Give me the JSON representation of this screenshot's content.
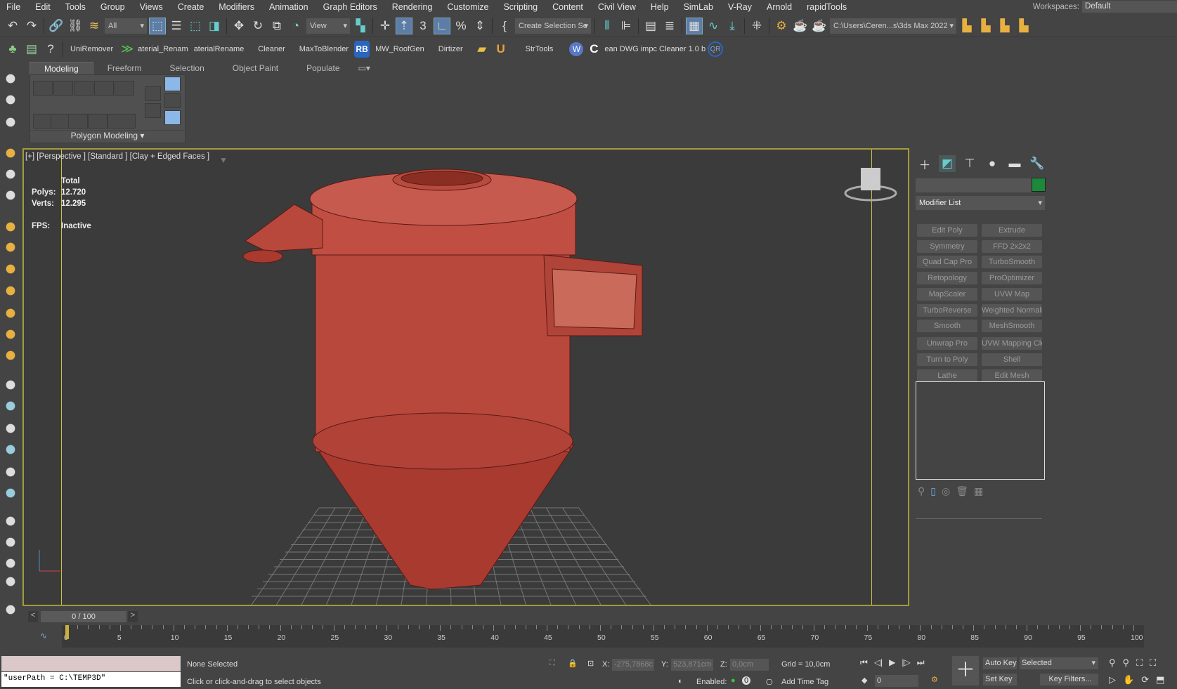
{
  "menu": [
    "File",
    "Edit",
    "Tools",
    "Group",
    "Views",
    "Create",
    "Modifiers",
    "Animation",
    "Graph Editors",
    "Rendering",
    "Customize",
    "Scripting",
    "Content",
    "Civil View",
    "Help",
    "SimLab",
    "V-Ray",
    "Arnold",
    "rapidTools"
  ],
  "workspaces": {
    "label": "Workspaces:",
    "value": "Default"
  },
  "toolbar": {
    "filter": "All",
    "ref_coord": "View",
    "selection_set": "Create Selection Se",
    "project_path": "C:\\Users\\Ceren...s\\3ds Max 2022"
  },
  "scripts_toolbar": [
    "UniRemover",
    "aterial_Renam",
    "aterialRename",
    "Cleaner",
    "MaxToBlender",
    "RB",
    "MW_RoofGen",
    "Dirtizer",
    "StrTools",
    "ean DWG impc Cleaner  1.0 b",
    "QR"
  ],
  "ribbon": {
    "tabs": [
      "Modeling",
      "Freeform",
      "Selection",
      "Object Paint",
      "Populate"
    ],
    "active": "Modeling",
    "panel_title": "Polygon Modeling"
  },
  "viewport": {
    "label": "[+] [Perspective ] [Standard ] [Clay + Edged Faces ]",
    "stats": {
      "total": "Total",
      "polys_label": "Polys:",
      "polys": "12.720",
      "verts_label": "Verts:",
      "verts": "12.295",
      "fps_label": "FPS:",
      "fps": "Inactive"
    },
    "object_color": "#b8483c"
  },
  "command_panel": {
    "modifier_list": "Modifier List",
    "swatch_color": "#1a8a3a",
    "modifiers": [
      "Edit Poly",
      "Extrude",
      "Symmetry",
      "FFD 2x2x2",
      "Quad Cap Pro",
      "TurboSmooth",
      "Retopology",
      "ProOptimizer",
      "MapScaler",
      "UVW Map",
      "TurboReverse",
      "Weighted Normals",
      "Smooth",
      "MeshSmooth",
      "Unwrap Pro",
      "UVW Mapping Clea",
      "Turn to Poly",
      "Shell",
      "Lathe",
      "Edit Mesh"
    ]
  },
  "timeline": {
    "frame": "0 / 100",
    "tick_labels": [
      "0",
      "5",
      "10",
      "15",
      "20",
      "25",
      "30",
      "35",
      "40",
      "45",
      "50",
      "55",
      "60",
      "65",
      "70",
      "75",
      "80",
      "85",
      "90",
      "95",
      "100"
    ]
  },
  "status": {
    "maxscript_output": "\"userPath = C:\\TEMP3D\"",
    "selection": "None Selected",
    "prompt": "Click or click-and-drag to select objects",
    "x_label": "X:",
    "x": "-275,7868c",
    "y_label": "Y:",
    "y": "523,871cm",
    "z_label": "Z:",
    "z": "0,0cm",
    "grid": "Grid = 10,0cm",
    "enabled": "Enabled:",
    "time_tag": "Add Time Tag",
    "auto_key": "Auto Key",
    "key_mode": "Selected",
    "set_key": "Set Key",
    "key_filters": "Key Filters...",
    "current_frame": "0",
    "enabled_count": "0"
  }
}
